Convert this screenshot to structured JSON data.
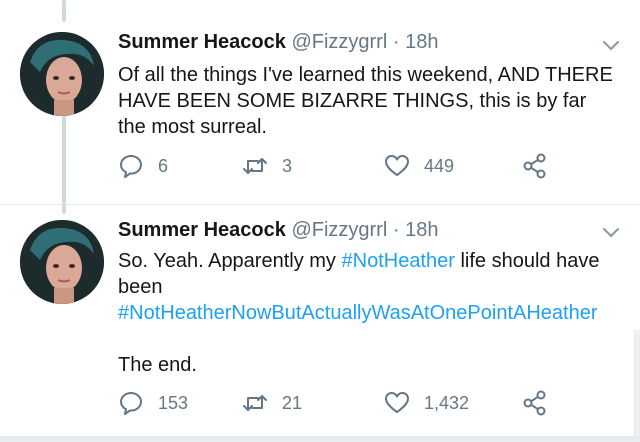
{
  "tweets": [
    {
      "author_name": "Summer Heacock",
      "author_handle": "@Fizzygrrl",
      "separator": "·",
      "time": "18h",
      "text": "Of all the things I've learned this weekend, AND THERE HAVE BEEN SOME BIZARRE THINGS, this is by far the most surreal.",
      "replies": "6",
      "retweets": "3",
      "likes": "449"
    },
    {
      "author_name": "Summer Heacock",
      "author_handle": "@Fizzygrrl",
      "separator": "·",
      "time": "18h",
      "text_before": "So. Yeah. Apparently my ",
      "hashtag_1": "#NotHeather",
      "text_middle": " life should have been",
      "hashtag_2": "#NotHeatherNowButActuallyWasAtOnePointAHeather",
      "text_end": "The end.",
      "replies": "153",
      "retweets": "21",
      "likes": "1,432"
    }
  ],
  "icons": {
    "reply": "reply-icon",
    "retweet": "retweet-icon",
    "like": "heart-icon",
    "share": "share-icon",
    "menu": "chevron-down-icon"
  },
  "colors": {
    "text": "#14171a",
    "muted": "#657786",
    "hashtag": "#1da1f2",
    "thread_line": "#cfd9de"
  }
}
